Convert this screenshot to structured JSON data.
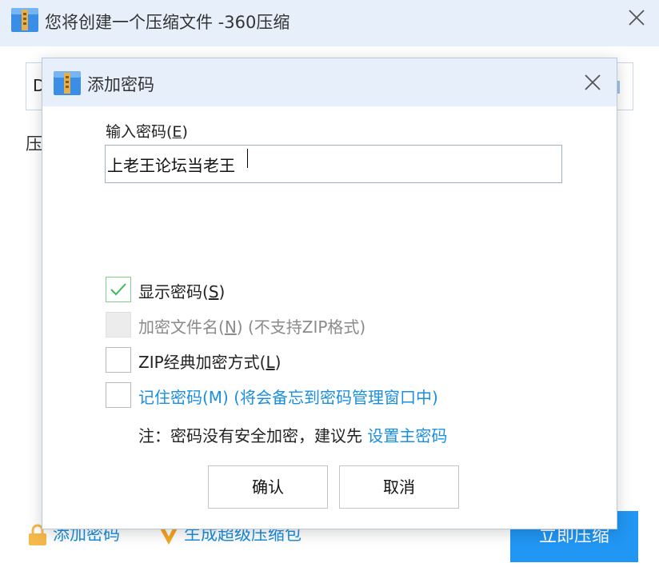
{
  "main_window": {
    "title": "您将创建一个压缩文件 -360压缩",
    "path_field_visible_text": "D",
    "compress_label_visible_text": "压",
    "add_password_link": "添加密码",
    "super_package_link": "生成超级压缩包",
    "compress_now_button": "立即压缩"
  },
  "dialog": {
    "title": "添加密码",
    "password_label": "输入密码(",
    "password_label_key": "E",
    "password_label_end": ")",
    "password_value": "上老王论坛当老王",
    "options": [
      {
        "label": "显示密码(",
        "key": "S",
        "end": ")",
        "checked": true,
        "disabled": false
      },
      {
        "label": "加密文件名(",
        "key": "N",
        "end": ") (不支持ZIP格式)",
        "checked": false,
        "disabled": true
      },
      {
        "label": "ZIP经典加密方式(",
        "key": "L",
        "end": ")",
        "checked": false,
        "disabled": false
      },
      {
        "label": "记住密码(M) (将会备忘到密码管理窗口中)",
        "checked": false,
        "disabled": false,
        "is_link": true
      }
    ],
    "note_text": "注：密码没有安全加密，建议先 ",
    "note_link": "设置主密码",
    "ok_button": "确认",
    "cancel_button": "取消"
  },
  "colors": {
    "titlebar_bg": "#e6effa",
    "link_blue": "#1a8fe0",
    "primary_button": "#2196f3",
    "checkbox_check": "#3cb95b",
    "icon_yellow": "#f5a623"
  },
  "icons": [
    "archive-app-icon",
    "close-icon",
    "checkmark-icon",
    "padlock-icon",
    "v-badge-icon"
  ]
}
